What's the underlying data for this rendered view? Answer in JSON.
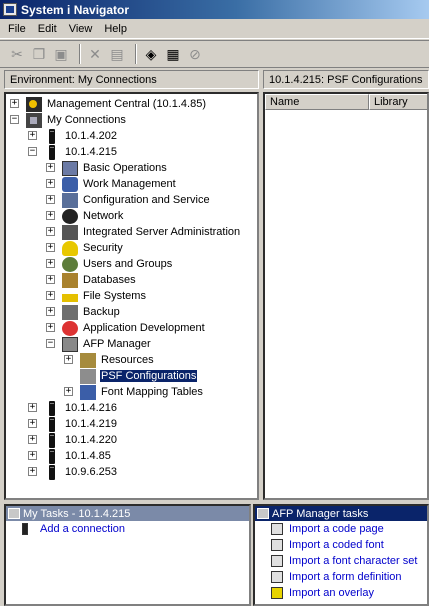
{
  "window": {
    "title": "System i Navigator"
  },
  "menu": [
    "File",
    "Edit",
    "View",
    "Help"
  ],
  "toolbar": {
    "icons": [
      "cut-icon",
      "copy-icon",
      "paste-icon",
      "delete-icon",
      "properties-icon",
      "plugins-icon",
      "options-icon",
      "stop-icon"
    ]
  },
  "left_header": "Environment: My Connections",
  "right_header": "10.1.4.215:  PSF Configurations",
  "tree": {
    "management_central": "Management Central (10.1.4.85)",
    "my_connections": "My Connections",
    "servers_before": [
      "10.1.4.202",
      "10.1.4.215"
    ],
    "functions": [
      "Basic Operations",
      "Work Management",
      "Configuration and Service",
      "Network",
      "Integrated Server Administration",
      "Security",
      "Users and Groups",
      "Databases",
      "File Systems",
      "Backup",
      "Application Development",
      "AFP Manager"
    ],
    "afp_children": [
      "Resources",
      "PSF Configurations",
      "Font Mapping Tables"
    ],
    "servers_after": [
      "10.1.4.216",
      "10.1.4.219",
      "10.1.4.220",
      "10.1.4.85",
      "10.9.6.253"
    ]
  },
  "list_columns": [
    "Name",
    "Library"
  ],
  "my_tasks": {
    "header": "My Tasks - 10.1.4.215",
    "items": [
      "Add a connection"
    ]
  },
  "afp_tasks": {
    "header": "AFP Manager tasks",
    "items": [
      "Import a code page",
      "Import a coded font",
      "Import a font character set",
      "Import a form definition",
      "Import an overlay"
    ]
  }
}
